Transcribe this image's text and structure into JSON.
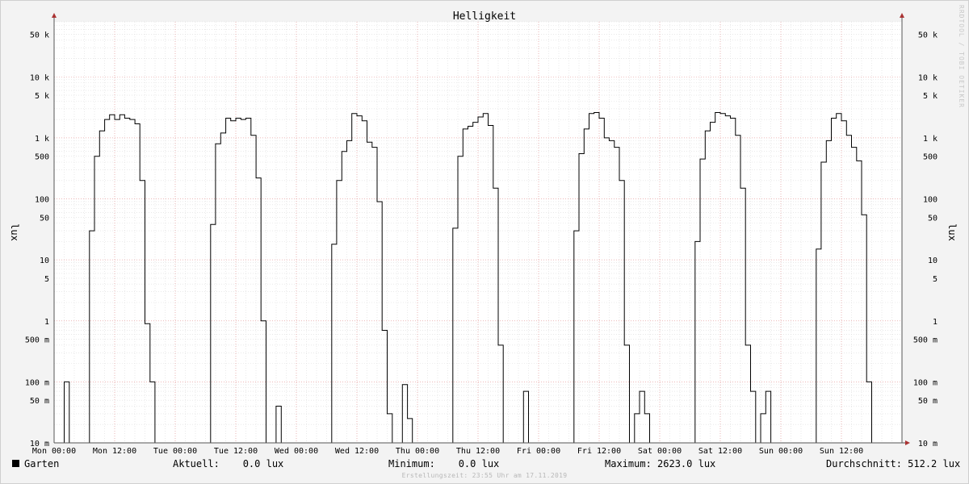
{
  "chart_data": {
    "type": "line",
    "title": "Helligkeit",
    "ylabel": "lux",
    "yscale": "log",
    "ylim": [
      0.01,
      80000
    ],
    "xlim": [
      0,
      7
    ],
    "grid": true,
    "y_ticks": [
      {
        "value": 0.01,
        "label": "10 m"
      },
      {
        "value": 0.05,
        "label": "50 m"
      },
      {
        "value": 0.1,
        "label": "100 m"
      },
      {
        "value": 0.5,
        "label": "500 m"
      },
      {
        "value": 1,
        "label": "1"
      },
      {
        "value": 5,
        "label": "5"
      },
      {
        "value": 10,
        "label": "10"
      },
      {
        "value": 50,
        "label": "50"
      },
      {
        "value": 100,
        "label": "100"
      },
      {
        "value": 500,
        "label": "500"
      },
      {
        "value": 1000,
        "label": "1 k"
      },
      {
        "value": 5000,
        "label": "5 k"
      },
      {
        "value": 10000,
        "label": "10 k"
      },
      {
        "value": 50000,
        "label": "50 k"
      }
    ],
    "x_ticks": [
      "Mon 00:00",
      "Mon 12:00",
      "Tue 00:00",
      "Tue 12:00",
      "Wed 00:00",
      "Wed 12:00",
      "Thu 00:00",
      "Thu 12:00",
      "Fri 00:00",
      "Fri 12:00",
      "Sat 00:00",
      "Sat 12:00",
      "Sun 00:00",
      "Sun 12:00"
    ],
    "series": [
      {
        "name": "Garten",
        "color": "#000000",
        "points": [
          [
            0.0,
            0.01
          ],
          [
            0.083,
            0.01
          ],
          [
            0.083,
            0.1
          ],
          [
            0.125,
            0.1
          ],
          [
            0.125,
            0.01
          ],
          [
            0.292,
            0.01
          ],
          [
            0.292,
            30
          ],
          [
            0.333,
            30
          ],
          [
            0.333,
            500
          ],
          [
            0.375,
            500
          ],
          [
            0.375,
            1300
          ],
          [
            0.417,
            1300
          ],
          [
            0.417,
            2000
          ],
          [
            0.458,
            2000
          ],
          [
            0.458,
            2400
          ],
          [
            0.5,
            2400
          ],
          [
            0.5,
            2000
          ],
          [
            0.542,
            2000
          ],
          [
            0.542,
            2400
          ],
          [
            0.583,
            2400
          ],
          [
            0.583,
            2100
          ],
          [
            0.625,
            2100
          ],
          [
            0.625,
            2000
          ],
          [
            0.667,
            2000
          ],
          [
            0.667,
            1700
          ],
          [
            0.708,
            1700
          ],
          [
            0.708,
            200
          ],
          [
            0.75,
            200
          ],
          [
            0.75,
            0.9
          ],
          [
            0.792,
            0.9
          ],
          [
            0.792,
            0.1
          ],
          [
            0.833,
            0.1
          ],
          [
            0.833,
            0.01
          ],
          [
            1.292,
            0.01
          ],
          [
            1.292,
            38
          ],
          [
            1.333,
            38
          ],
          [
            1.333,
            800
          ],
          [
            1.375,
            800
          ],
          [
            1.375,
            1200
          ],
          [
            1.417,
            1200
          ],
          [
            1.417,
            2100
          ],
          [
            1.458,
            2100
          ],
          [
            1.458,
            1900
          ],
          [
            1.5,
            1900
          ],
          [
            1.5,
            2100
          ],
          [
            1.542,
            2100
          ],
          [
            1.542,
            2000
          ],
          [
            1.583,
            2000
          ],
          [
            1.583,
            2100
          ],
          [
            1.625,
            2100
          ],
          [
            1.625,
            1100
          ],
          [
            1.667,
            1100
          ],
          [
            1.667,
            220
          ],
          [
            1.708,
            220
          ],
          [
            1.708,
            1
          ],
          [
            1.75,
            1
          ],
          [
            1.75,
            0.01
          ],
          [
            1.833,
            0.01
          ],
          [
            1.833,
            0.04
          ],
          [
            1.875,
            0.04
          ],
          [
            1.875,
            0.01
          ],
          [
            2.292,
            0.01
          ],
          [
            2.292,
            18
          ],
          [
            2.333,
            18
          ],
          [
            2.333,
            200
          ],
          [
            2.375,
            200
          ],
          [
            2.375,
            600
          ],
          [
            2.417,
            600
          ],
          [
            2.417,
            900
          ],
          [
            2.458,
            900
          ],
          [
            2.458,
            2500
          ],
          [
            2.5,
            2500
          ],
          [
            2.5,
            2300
          ],
          [
            2.542,
            2300
          ],
          [
            2.542,
            1900
          ],
          [
            2.583,
            1900
          ],
          [
            2.583,
            850
          ],
          [
            2.625,
            850
          ],
          [
            2.625,
            700
          ],
          [
            2.667,
            700
          ],
          [
            2.667,
            90
          ],
          [
            2.708,
            90
          ],
          [
            2.708,
            0.7
          ],
          [
            2.75,
            0.7
          ],
          [
            2.75,
            0.03
          ],
          [
            2.792,
            0.03
          ],
          [
            2.792,
            0.01
          ],
          [
            2.875,
            0.01
          ],
          [
            2.875,
            0.09
          ],
          [
            2.917,
            0.09
          ],
          [
            2.917,
            0.025
          ],
          [
            2.958,
            0.025
          ],
          [
            2.958,
            0.01
          ],
          [
            3.292,
            0.01
          ],
          [
            3.292,
            33
          ],
          [
            3.333,
            33
          ],
          [
            3.333,
            500
          ],
          [
            3.375,
            500
          ],
          [
            3.375,
            1400
          ],
          [
            3.417,
            1400
          ],
          [
            3.417,
            1550
          ],
          [
            3.458,
            1550
          ],
          [
            3.458,
            1800
          ],
          [
            3.5,
            1800
          ],
          [
            3.5,
            2200
          ],
          [
            3.542,
            2200
          ],
          [
            3.542,
            2500
          ],
          [
            3.583,
            2500
          ],
          [
            3.583,
            1600
          ],
          [
            3.625,
            1600
          ],
          [
            3.625,
            150
          ],
          [
            3.667,
            150
          ],
          [
            3.667,
            0.4
          ],
          [
            3.708,
            0.4
          ],
          [
            3.708,
            0.01
          ],
          [
            3.875,
            0.01
          ],
          [
            3.875,
            0.07
          ],
          [
            3.917,
            0.07
          ],
          [
            3.917,
            0.01
          ],
          [
            4.292,
            0.01
          ],
          [
            4.292,
            30
          ],
          [
            4.333,
            30
          ],
          [
            4.333,
            550
          ],
          [
            4.375,
            550
          ],
          [
            4.375,
            1400
          ],
          [
            4.417,
            1400
          ],
          [
            4.417,
            2500
          ],
          [
            4.458,
            2500
          ],
          [
            4.458,
            2600
          ],
          [
            4.5,
            2600
          ],
          [
            4.5,
            2100
          ],
          [
            4.542,
            2100
          ],
          [
            4.542,
            1000
          ],
          [
            4.583,
            1000
          ],
          [
            4.583,
            900
          ],
          [
            4.625,
            900
          ],
          [
            4.625,
            700
          ],
          [
            4.667,
            700
          ],
          [
            4.667,
            200
          ],
          [
            4.708,
            200
          ],
          [
            4.708,
            0.4
          ],
          [
            4.75,
            0.4
          ],
          [
            4.75,
            0.01
          ],
          [
            4.792,
            0.01
          ],
          [
            4.792,
            0.03
          ],
          [
            4.833,
            0.03
          ],
          [
            4.833,
            0.07
          ],
          [
            4.875,
            0.07
          ],
          [
            4.875,
            0.03
          ],
          [
            4.917,
            0.03
          ],
          [
            4.917,
            0.01
          ],
          [
            5.292,
            0.01
          ],
          [
            5.292,
            20
          ],
          [
            5.333,
            20
          ],
          [
            5.333,
            450
          ],
          [
            5.375,
            450
          ],
          [
            5.375,
            1300
          ],
          [
            5.417,
            1300
          ],
          [
            5.417,
            1800
          ],
          [
            5.458,
            1800
          ],
          [
            5.458,
            2600
          ],
          [
            5.5,
            2600
          ],
          [
            5.5,
            2500
          ],
          [
            5.542,
            2500
          ],
          [
            5.542,
            2300
          ],
          [
            5.583,
            2300
          ],
          [
            5.583,
            2100
          ],
          [
            5.625,
            2100
          ],
          [
            5.625,
            1100
          ],
          [
            5.667,
            1100
          ],
          [
            5.667,
            150
          ],
          [
            5.708,
            150
          ],
          [
            5.708,
            0.4
          ],
          [
            5.75,
            0.4
          ],
          [
            5.75,
            0.07
          ],
          [
            5.792,
            0.07
          ],
          [
            5.792,
            0.01
          ],
          [
            5.833,
            0.01
          ],
          [
            5.833,
            0.03
          ],
          [
            5.875,
            0.03
          ],
          [
            5.875,
            0.07
          ],
          [
            5.917,
            0.07
          ],
          [
            5.917,
            0.01
          ],
          [
            6.292,
            0.01
          ],
          [
            6.292,
            15
          ],
          [
            6.333,
            15
          ],
          [
            6.333,
            400
          ],
          [
            6.375,
            400
          ],
          [
            6.375,
            900
          ],
          [
            6.417,
            900
          ],
          [
            6.417,
            2100
          ],
          [
            6.458,
            2100
          ],
          [
            6.458,
            2500
          ],
          [
            6.5,
            2500
          ],
          [
            6.5,
            1900
          ],
          [
            6.542,
            1900
          ],
          [
            6.542,
            1100
          ],
          [
            6.583,
            1100
          ],
          [
            6.583,
            700
          ],
          [
            6.625,
            700
          ],
          [
            6.625,
            420
          ],
          [
            6.667,
            420
          ],
          [
            6.667,
            55
          ],
          [
            6.708,
            55
          ],
          [
            6.708,
            0.1
          ],
          [
            6.75,
            0.1
          ],
          [
            6.75,
            0.01
          ],
          [
            7.0,
            0.01
          ]
        ]
      }
    ]
  },
  "legend": {
    "series_name": "Garten",
    "aktuell": "Aktuell:    0.0 lux",
    "minimum": "Minimum:    0.0 lux",
    "maximum": "Maximum: 2623.0 lux",
    "durchschnitt": "Durchschnitt: 512.2 lux"
  },
  "footer": "Erstellungszeit: 23:55 Uhr am 17.11.2019",
  "watermark": "RRDTOOL / TOBI OETIKER"
}
